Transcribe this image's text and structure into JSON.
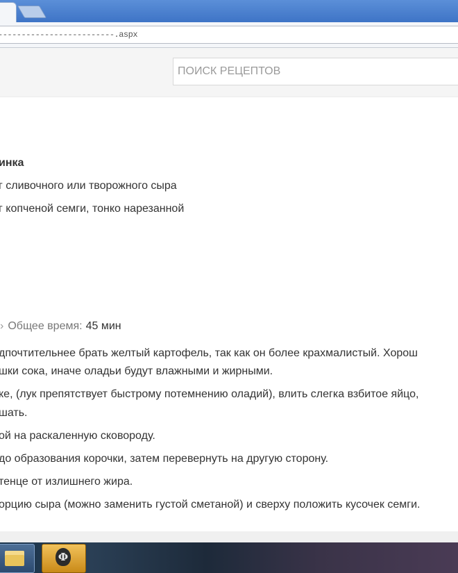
{
  "browser": {
    "tab_close_glyph": "×",
    "url": "-------------------------.aspx"
  },
  "search": {
    "placeholder": "ПОИСК РЕЦЕПТОВ"
  },
  "ingredients": {
    "title": "инка",
    "items": [
      "г сливочного или творожного сыра",
      "г копченой семги, тонко нарезанной"
    ]
  },
  "total_time": {
    "label": "Общее время:",
    "value": "45 мин"
  },
  "steps": [
    "дпочтительнее брать желтый картофель, так как он более крахмалистый. Хорош",
    "шки сока, иначе оладьи будут влажными и жирными.",
    "ке, (лук препятствует быстрому потемнению оладий), влить слегка взбитое яйцо,",
    "шать.",
    "ой на раскаленную сковороду.",
    "до образования корочки, затем перевернуть на другую сторону.",
    "тенце от излишнего жира.",
    "орцию сыра (можно заменить густой сметаной) и сверху положить кусочек семги."
  ],
  "taskbar": {
    "apps": [
      "folder-icon",
      "world-of-tanks-icon"
    ],
    "game_glyph": "Ф"
  },
  "colors": {
    "tabbar": "#3e74c6",
    "header_bg": "#f5f5f5",
    "text": "#333333",
    "muted": "#777777"
  }
}
